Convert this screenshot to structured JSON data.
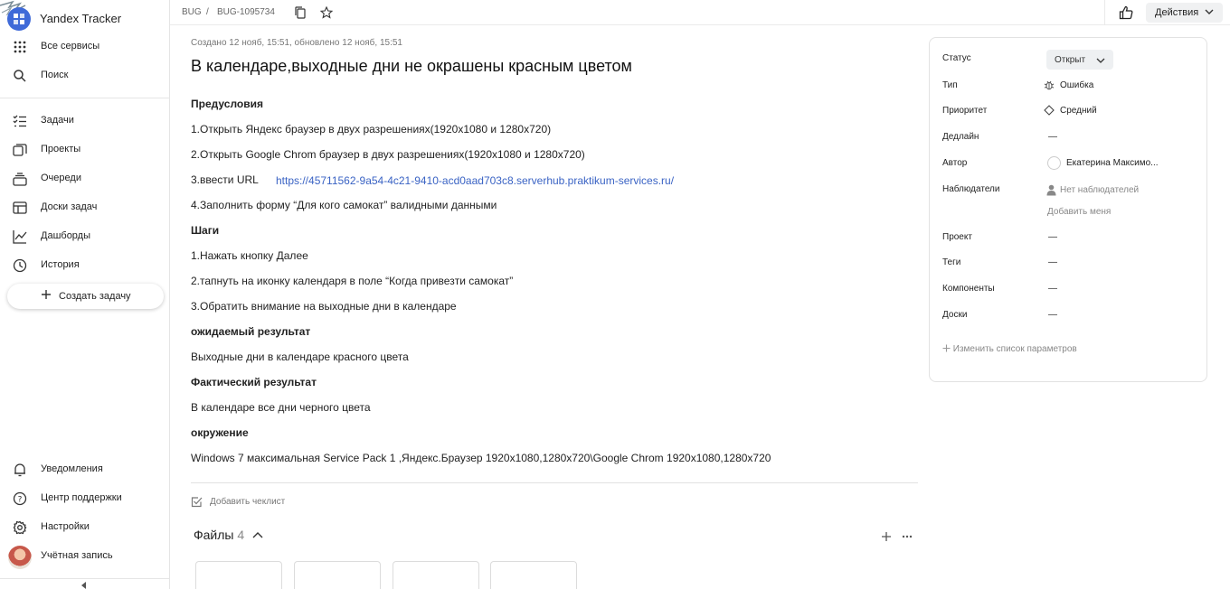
{
  "sidebar": {
    "app_title": "Yandex Tracker",
    "items_top": [
      {
        "label": "Все сервисы",
        "icon": "grid-icon"
      },
      {
        "label": "Поиск",
        "icon": "search-icon"
      }
    ],
    "items_main": [
      {
        "label": "Задачи",
        "icon": "tasks-icon"
      },
      {
        "label": "Проекты",
        "icon": "projects-icon"
      },
      {
        "label": "Очереди",
        "icon": "queues-icon"
      },
      {
        "label": "Доски задач",
        "icon": "boards-icon"
      },
      {
        "label": "Дашборды",
        "icon": "dashboards-icon"
      },
      {
        "label": "История",
        "icon": "history-icon"
      }
    ],
    "create_label": "Создать задачу",
    "items_bottom": [
      {
        "label": "Уведомления",
        "icon": "bell-icon"
      },
      {
        "label": "Центр поддержки",
        "icon": "help-icon"
      },
      {
        "label": "Настройки",
        "icon": "gear-icon"
      },
      {
        "label": "Учётная запись",
        "icon": "avatar"
      }
    ]
  },
  "topbar": {
    "queue": "BUG",
    "separator": "/",
    "issue_key": "BUG-1095734",
    "actions_label": "Действия"
  },
  "issue": {
    "meta": "Создано 12 нояб, 15:51, обновлено 12 нояб, 15:51",
    "title": "В календаре,выходные дни не окрашены красным цветом",
    "lines": [
      {
        "text": "Предусловия",
        "bold": true
      },
      {
        "text": "1.Открыть Яндекс браузер в двух разрешениях(1920х1080 и 1280х720)",
        "bold": false
      },
      {
        "text": "2.Открыть Google Chrom браузер в двух разрешениях(1920х1080 и 1280х720)",
        "bold": false
      },
      {
        "text": "3.ввести URL",
        "bold": false
      },
      {
        "text": "4.Заполнить форму “Для кого самокат” валидными данными",
        "bold": false
      },
      {
        "text": "Шаги",
        "bold": true
      },
      {
        "text": "1.Нажать кнопку Далее",
        "bold": false
      },
      {
        "text": "2.тапнуть на иконку календаря в поле “Когда привезти самокат”",
        "bold": false
      },
      {
        "text": "3.Обратить внимание на выходные дни в календаре",
        "bold": false
      },
      {
        "text": "ожидаемый результат",
        "bold": true
      },
      {
        "text": "Выходные дни в календаре красного цвета",
        "bold": false
      },
      {
        "text": "Фактический результат",
        "bold": true
      },
      {
        "text": "В календаре все дни черного цвета",
        "bold": false
      },
      {
        "text": "окружение",
        "bold": true
      },
      {
        "text": "Windows 7 максимальная Service Pack 1 ,Яндекс.Браузер 1920х1080,1280х720\\Google Chrom 1920х1080,1280х720",
        "bold": false
      }
    ],
    "url": "https://45711562-9a54-4c21-9410-acd0aad703c8.serverhub.praktikum-services.ru/",
    "add_checklist": "Добавить чеклист",
    "files_label": "Файлы",
    "files_count": "4"
  },
  "panel": {
    "status_label": "Статус",
    "status_value": "Открыт",
    "type_label": "Тип",
    "type_value": "Ошибка",
    "priority_label": "Приоритет",
    "priority_value": "Средний",
    "deadline_label": "Дедлайн",
    "deadline_value": "—",
    "author_label": "Автор",
    "author_value": "Екатерина Максимо...",
    "watchers_label": "Наблюдатели",
    "watchers_value": "Нет наблюдателей",
    "add_me": "Добавить меня",
    "project_label": "Проект",
    "project_value": "—",
    "tags_label": "Теги",
    "tags_value": "—",
    "components_label": "Компоненты",
    "components_value": "—",
    "boards_label": "Доски",
    "boards_value": "—",
    "change_params": "Изменить список параметров"
  },
  "colors": {
    "accent": "#3f6ad8",
    "link": "#3a63c4",
    "muted": "#777777"
  }
}
